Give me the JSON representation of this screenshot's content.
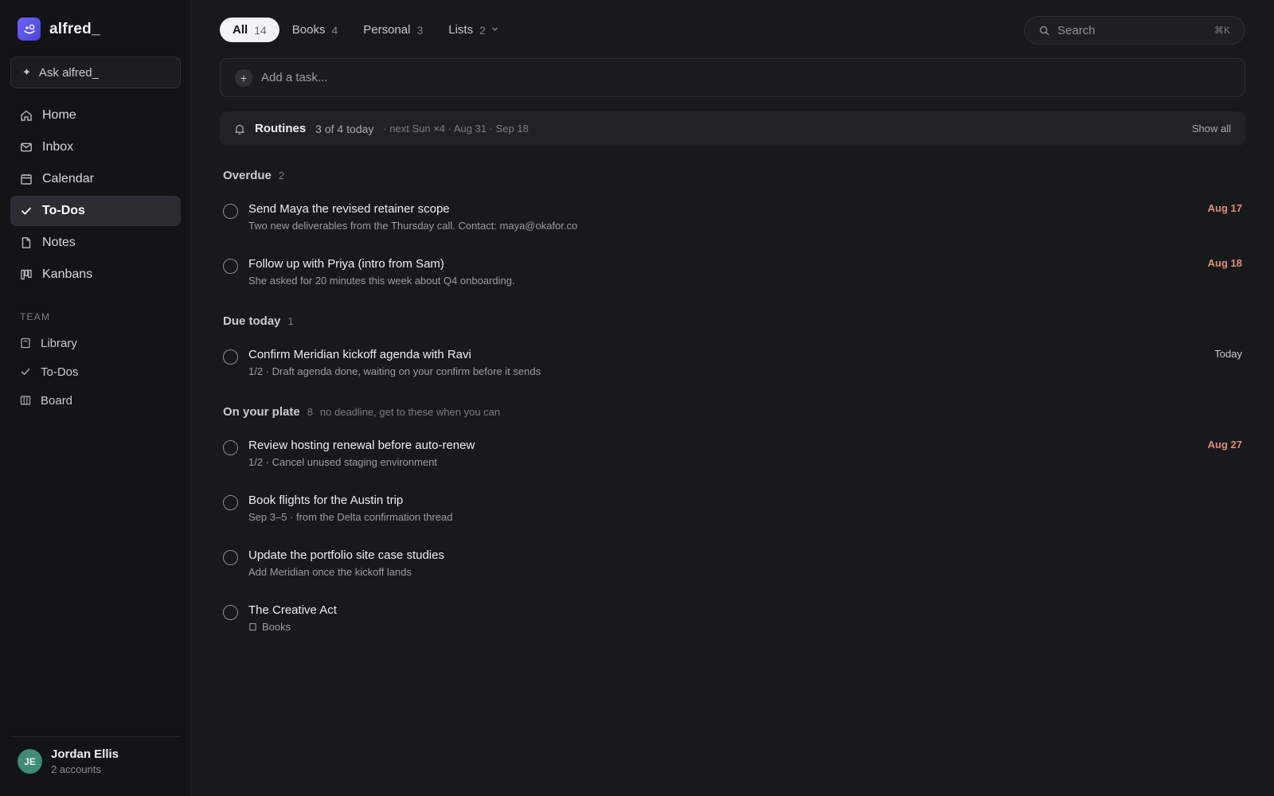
{
  "brand": {
    "name": "alfred_"
  },
  "sidebar": {
    "ask_label": "Ask alfred_",
    "items": [
      {
        "label": "Home",
        "icon": "home-icon"
      },
      {
        "label": "Inbox",
        "icon": "mail-icon"
      },
      {
        "label": "Calendar",
        "icon": "calendar-icon"
      },
      {
        "label": "To-Dos",
        "icon": "check-icon",
        "active": true
      },
      {
        "label": "Notes",
        "icon": "note-icon"
      },
      {
        "label": "Kanbans",
        "icon": "kanban-icon"
      }
    ],
    "team_label": "TEAM",
    "team_items": [
      {
        "label": "Library",
        "icon": "book-icon"
      },
      {
        "label": "To-Dos",
        "icon": "check-icon"
      },
      {
        "label": "Board",
        "icon": "board-icon"
      }
    ],
    "account": {
      "initials": "JE",
      "name": "Jordan Ellis",
      "sub": "2 accounts",
      "color": "#3f8b74"
    }
  },
  "tabs": [
    {
      "label": "All",
      "count": "14",
      "active": true
    },
    {
      "label": "Books",
      "count": "4"
    },
    {
      "label": "Personal",
      "count": "3"
    },
    {
      "label": "Lists",
      "count": "2"
    }
  ],
  "search": {
    "placeholder": "Search",
    "shortcut": "⌘K"
  },
  "add_task": {
    "placeholder": "Add a task..."
  },
  "routines": {
    "title": "Routines",
    "count": "3 of 4 today",
    "next": "· next Sun ×4 · Aug 31 · Sep 18",
    "show_all": "Show all"
  },
  "sections": {
    "overdue": {
      "title": "Overdue",
      "count": "2"
    },
    "today": {
      "title": "Due today",
      "count": "1"
    },
    "plate": {
      "title": "On your plate",
      "count": "8",
      "note": "no deadline, get to these when you can"
    }
  },
  "tasks": [
    {
      "title": "Send Maya the revised retainer scope",
      "sub": "Two new deliverables from the Thursday call. Contact: maya@okafor.co",
      "due": "Aug 17"
    },
    {
      "title": "Follow up with Priya (intro from Sam)",
      "sub": "She asked for 20 minutes this week about Q4 onboarding.",
      "due": "Aug 18"
    },
    {
      "title": "Confirm Meridian kickoff agenda with Ravi",
      "sub": "1/2 · Draft agenda done, waiting on your confirm before it sends",
      "due": "Today"
    },
    {
      "title": "Review hosting renewal before auto-renew",
      "sub": "1/2 · Cancel unused staging environment",
      "due": "Aug 27"
    },
    {
      "title": "Book flights for the Austin trip",
      "sub": "Sep 3–5 · from the Delta confirmation thread",
      "due": ""
    },
    {
      "title": "Update the portfolio site case studies",
      "sub": "Add Meridian once the kickoff lands",
      "due": ""
    },
    {
      "title": "The Creative Act",
      "sub": "Books",
      "due": ""
    }
  ],
  "colors": {
    "accent": "#6c63ff",
    "overdue": "#e08d7e",
    "background": "#17191b",
    "sidebar": "#121416"
  }
}
